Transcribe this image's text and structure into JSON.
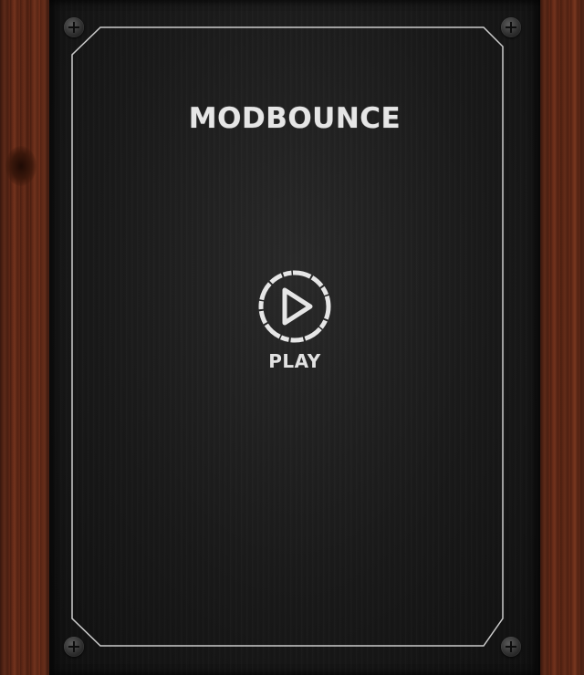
{
  "game": {
    "title": "MODBOUNCE",
    "play_label": "PLAY"
  },
  "icons": {
    "play": "play-circle-icon",
    "screw": "screw-icon"
  },
  "colors": {
    "board": "#1a1a1a",
    "frame_line": "#e0e0e0",
    "text": "#e6e6e6",
    "wood": "#5a2514"
  }
}
